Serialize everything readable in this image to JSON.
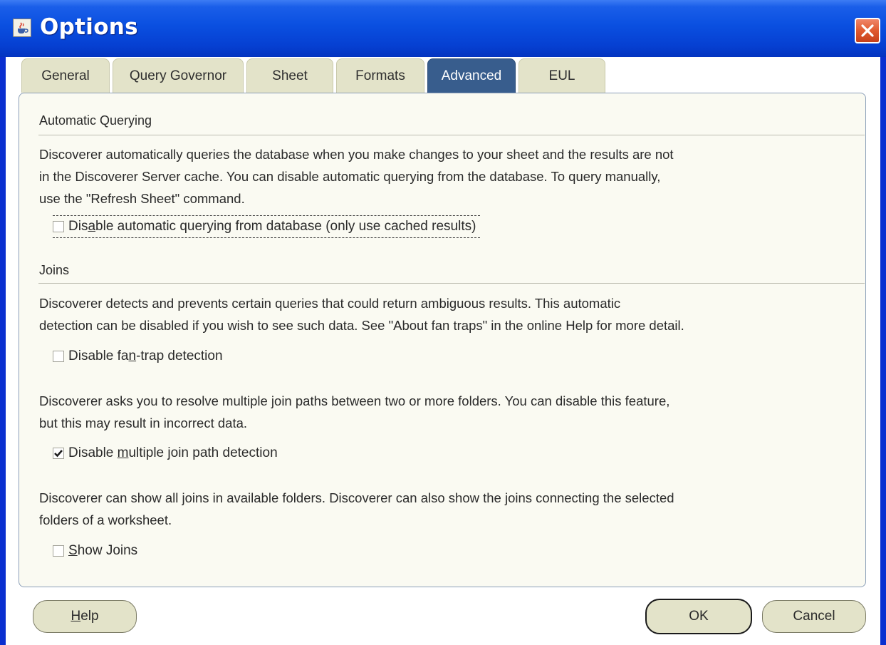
{
  "window": {
    "title": "Options",
    "app_icon": "java-cup-icon",
    "close_icon": "close-icon"
  },
  "tabs": [
    {
      "label": "General",
      "active": false
    },
    {
      "label": "Query Governor",
      "active": false
    },
    {
      "label": "Sheet",
      "active": false
    },
    {
      "label": "Formats",
      "active": false
    },
    {
      "label": "Advanced",
      "active": true
    },
    {
      "label": "EUL",
      "active": false
    }
  ],
  "automatic_querying": {
    "title": "Automatic Querying",
    "lines": [
      "Discoverer automatically queries the database when you make changes to your sheet and the results are not",
      "in the Discoverer Server cache.  You can disable automatic querying from the database.  To query manually,",
      "use the \"Refresh Sheet\" command."
    ],
    "checkbox": {
      "pre": "Dis",
      "mnemonic": "a",
      "post": "ble automatic querying from database (only use cached results)",
      "checked": false
    }
  },
  "joins": {
    "title": "Joins",
    "fan_trap": {
      "lines": [
        "Discoverer detects and prevents certain queries that could return ambiguous results. This automatic",
        "detection can be disabled if you wish to see such data. See \"About fan traps\" in the online Help for more detail."
      ],
      "checkbox": {
        "pre": "Disable fa",
        "mnemonic": "n",
        "post": "-trap detection",
        "checked": false
      }
    },
    "multi_join": {
      "lines": [
        "Discoverer asks you to resolve multiple join paths between two or more folders. You can disable this feature,",
        "but this may result in incorrect data."
      ],
      "checkbox": {
        "pre": "Disable ",
        "mnemonic": "m",
        "post": "ultiple join path detection",
        "checked": true
      }
    },
    "show_joins": {
      "lines": [
        "Discoverer can show all joins in available folders. Discoverer can also show the joins connecting the selected",
        "folders of a worksheet."
      ],
      "checkbox": {
        "pre": "",
        "mnemonic": "S",
        "post": "how Joins",
        "checked": false
      }
    }
  },
  "buttons": {
    "help": {
      "mnemonic": "H",
      "rest": "elp"
    },
    "ok": "OK",
    "cancel": "Cancel"
  },
  "colors": {
    "titlebar": "#0a4fe0",
    "active_tab": "#385d8d",
    "tab": "#e3e3c9",
    "panel": "#fafaf2"
  }
}
